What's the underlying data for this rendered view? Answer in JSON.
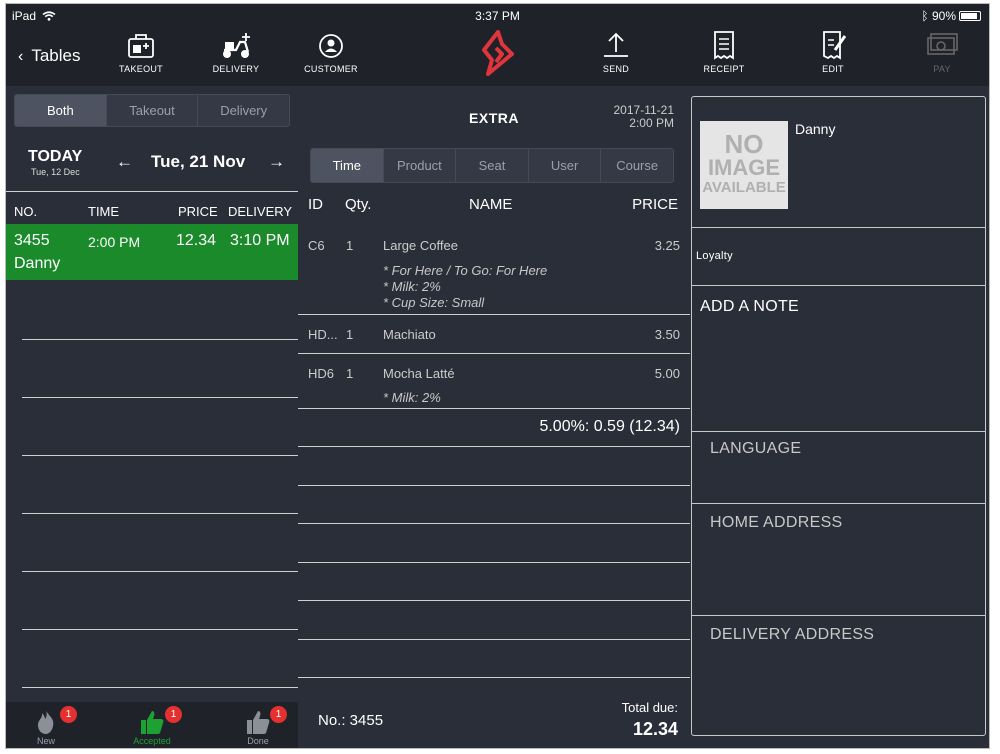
{
  "status": {
    "device": "iPad",
    "time": "3:37 PM",
    "battery": "90%"
  },
  "toolbar": {
    "back_label": "Tables",
    "takeout": "TAKEOUT",
    "delivery": "DELIVERY",
    "customer": "CUSTOMER",
    "send": "SEND",
    "receipt": "RECEIPT",
    "edit": "EDIT",
    "pay": "PAY"
  },
  "filter": {
    "tabs": [
      "Both",
      "Takeout",
      "Delivery"
    ],
    "active": "Both"
  },
  "date": {
    "today_label": "TODAY",
    "today_sub": "Tue, 12 Dec",
    "selected": "Tue, 21 Nov",
    "prev": "←",
    "next": "→"
  },
  "orders": {
    "headers": [
      "NO.",
      "TIME",
      "PRICE",
      "DELIVERY"
    ],
    "rows": [
      {
        "no": "3455",
        "time": "2:00 PM",
        "price": "12.34",
        "delivery": "3:10 PM",
        "name": "Danny"
      }
    ]
  },
  "bottom_tabs": [
    {
      "label": "New",
      "badge": "1"
    },
    {
      "label": "Accepted",
      "badge": "1"
    },
    {
      "label": "Done",
      "badge": "1"
    }
  ],
  "ticket": {
    "title": "EXTRA",
    "date": "2017-11-21",
    "time": "2:00 PM",
    "sort_tabs": [
      "Time",
      "Product",
      "Seat",
      "User",
      "Course"
    ],
    "active_sort": "Time",
    "headers": {
      "id": "ID",
      "qty": "Qty.",
      "name": "NAME",
      "price": "PRICE"
    },
    "items": [
      {
        "id": "C6",
        "qty": "1",
        "name": "Large Coffee",
        "price": "3.25",
        "mods": [
          "* For Here / To Go: For Here",
          "* Milk: 2%",
          "* Cup Size: Small"
        ]
      },
      {
        "id": "HD...",
        "qty": "1",
        "name": "Machiato",
        "price": "3.50",
        "mods": []
      },
      {
        "id": "HD6",
        "qty": "1",
        "name": "Mocha Latté",
        "price": "5.00",
        "mods": [
          "* Milk: 2%"
        ]
      }
    ],
    "tax_line": "5.00%: 0.59 (12.34)",
    "order_no": "No.: 3455",
    "total_label": "Total due:",
    "total_value": "12.34"
  },
  "customer": {
    "no_image": [
      "NO",
      "IMAGE",
      "AVAILABLE"
    ],
    "name": "Danny",
    "loyalty": "Loyalty",
    "add_note": "ADD A NOTE",
    "language": "LANGUAGE",
    "home_address": "HOME ADDRESS",
    "delivery_address": "DELIVERY ADDRESS"
  },
  "colors": {
    "accent_green": "#1a8a2a",
    "logo_red": "#e0353d",
    "badge_red": "#e53030"
  }
}
